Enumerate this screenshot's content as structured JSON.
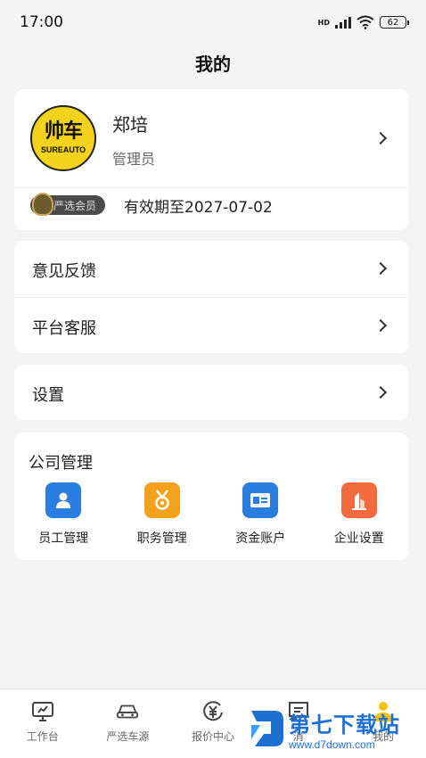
{
  "status_bar": {
    "time": "17:00",
    "network": "HD",
    "battery": "62"
  },
  "header": {
    "title": "我的"
  },
  "profile": {
    "avatar_brand": "帅车",
    "avatar_brand_en": "SUREAUTO",
    "name": "郑培",
    "role": "管理员",
    "vip_label": "严选会员",
    "expire_text": "有效期至2027-07-02"
  },
  "menu_1": [
    {
      "label": "意见反馈"
    },
    {
      "label": "平台客服"
    }
  ],
  "menu_2": [
    {
      "label": "设置"
    }
  ],
  "company": {
    "title": "公司管理",
    "items": [
      {
        "label": "员工管理",
        "icon": "user-icon",
        "color": "#2a7de1"
      },
      {
        "label": "职务管理",
        "icon": "medal-icon",
        "color": "#f3a21c"
      },
      {
        "label": "资金账户",
        "icon": "card-icon",
        "color": "#2a7de1"
      },
      {
        "label": "企业设置",
        "icon": "building-icon",
        "color": "#f26a3d"
      }
    ]
  },
  "tabbar": [
    {
      "label": "工作台",
      "icon": "monitor-icon"
    },
    {
      "label": "严选车源",
      "icon": "car-icon"
    },
    {
      "label": "报价中心",
      "icon": "yuan-icon"
    },
    {
      "label": "消",
      "icon": "message-icon"
    },
    {
      "label": "我的",
      "icon": "profile-icon"
    }
  ],
  "watermark": {
    "title": "第七下载站",
    "url": "www.d7down.com"
  }
}
